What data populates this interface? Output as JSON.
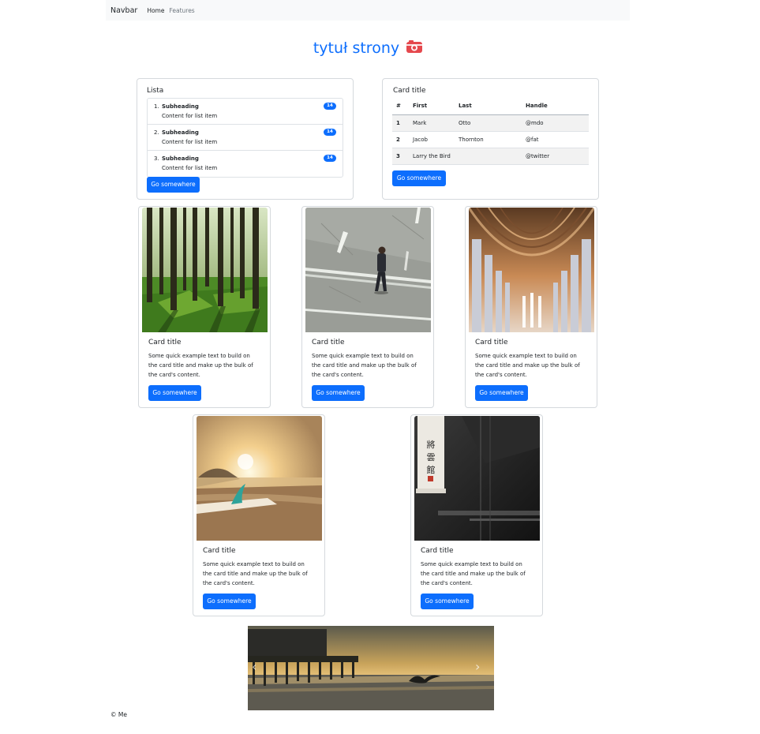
{
  "navbar": {
    "brand": "Navbar",
    "links": [
      "Home",
      "Features"
    ]
  },
  "page": {
    "title": "tytuł strony",
    "title_icon": "camera-icon",
    "accent": "#0d6efd"
  },
  "list_card": {
    "title": "Lista",
    "items": [
      {
        "num": "1.",
        "heading": "Subheading",
        "content": "Content for list item",
        "badge": "14"
      },
      {
        "num": "2.",
        "heading": "Subheading",
        "content": "Content for list item",
        "badge": "14"
      },
      {
        "num": "3.",
        "heading": "Subheading",
        "content": "Content for list item",
        "badge": "14"
      }
    ],
    "button": "Go somewhere"
  },
  "table_card": {
    "title": "Card title",
    "headers": [
      "#",
      "First",
      "Last",
      "Handle"
    ],
    "rows": [
      [
        "1",
        "Mark",
        "Otto",
        "@mdo"
      ],
      [
        "2",
        "Jacob",
        "Thornton",
        "@fat"
      ],
      [
        "3",
        "Larry the Bird",
        "",
        "@twitter"
      ]
    ],
    "button": "Go somewhere"
  },
  "cards": [
    {
      "image": "forest",
      "title": "Card title",
      "text": "Some quick example text to build on the card title and make up the bulk of the card's content.",
      "button": "Go somewhere"
    },
    {
      "image": "man-on-road",
      "title": "Card title",
      "text": "Some quick example text to build on the card title and make up the bulk of the card's content.",
      "button": "Go somewhere"
    },
    {
      "image": "cathedral-arches",
      "title": "Card title",
      "text": "Some quick example text to build on the card title and make up the bulk of the card's content.",
      "button": "Go somewhere"
    },
    {
      "image": "beach-surfboard",
      "title": "Card title",
      "text": "Some quick example text to build on the card title and make up the bulk of the card's content.",
      "button": "Go somewhere"
    },
    {
      "image": "paper-lantern",
      "title": "Card title",
      "text": "Some quick example text to build on the card title and make up the bulk of the card's content.",
      "button": "Go somewhere"
    }
  ],
  "carousel": {
    "image": "pier-sunset-seagull",
    "prev_icon": "chevron-left-icon",
    "next_icon": "chevron-right-icon"
  },
  "footer": {
    "text": "© Me"
  }
}
